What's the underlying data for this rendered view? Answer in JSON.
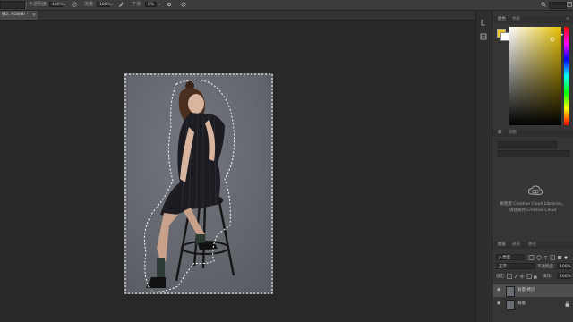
{
  "options_bar": {
    "opacity_label": "不透明度:",
    "opacity_value": "100%",
    "flow_label": "流量:",
    "flow_value": "100%",
    "smooth_label": "平滑:",
    "smooth_value": "0%"
  },
  "document": {
    "tab_title": "婚2, RGB/8) *"
  },
  "panels": {
    "color_tab": "颜色",
    "swatches_tab": "色板",
    "libraries_tab": "库",
    "adjust_tab": "调整",
    "cc_line1": "要使用 Creative Cloud Libraries，",
    "cc_line2": "请登录到 Creative Cloud",
    "layers_tab": "图层",
    "channels_tab": "通道",
    "paths_tab": "路径",
    "kind_label": "ρ 类型",
    "blend_mode": "正常",
    "opacity_label": "不透明度:",
    "opacity_value": "100%",
    "lock_label": "锁定:",
    "fill_label": "填充:",
    "fill_value": "100%",
    "layers": [
      {
        "name": "背景 拷贝",
        "selected": true
      },
      {
        "name": "背景",
        "selected": false
      }
    ]
  },
  "colors": {
    "foreground": "#e8c81c",
    "background": "#ffffff",
    "backdrop": "#676972"
  }
}
